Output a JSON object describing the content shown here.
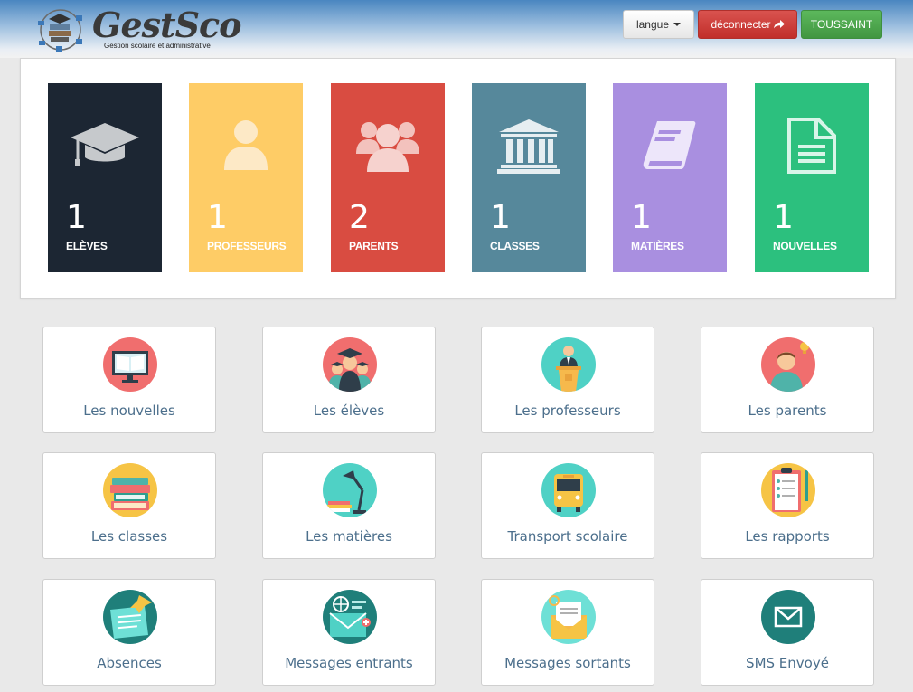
{
  "header": {
    "logo_text": "GestSco",
    "logo_subtitle": "Gestion scolaire et administrative",
    "langue_label": "langue",
    "logout_label": "déconnecter",
    "user_label": "TOUSSAINT"
  },
  "stats": [
    {
      "value": "1",
      "label": "ELÈVES",
      "color": "#1c2633",
      "icon": "graduation-cap-icon"
    },
    {
      "value": "1",
      "label": "PROFESSEURS",
      "color": "#fecc66",
      "icon": "user-icon"
    },
    {
      "value": "2",
      "label": "PARENTS",
      "color": "#d94c41",
      "icon": "users-icon"
    },
    {
      "value": "1",
      "label": "CLASSES",
      "color": "#56889b",
      "icon": "institution-icon"
    },
    {
      "value": "1",
      "label": "MATIÈRES",
      "color": "#a98fe0",
      "icon": "book-icon"
    },
    {
      "value": "1",
      "label": "NOUVELLES",
      "color": "#2cc07e",
      "icon": "document-icon"
    }
  ],
  "tiles": [
    {
      "label": "Les nouvelles",
      "icon": "monitor-news-icon"
    },
    {
      "label": "Les élèves",
      "icon": "students-icon"
    },
    {
      "label": "Les professeurs",
      "icon": "teacher-icon"
    },
    {
      "label": "Les parents",
      "icon": "parent-icon"
    },
    {
      "label": "Les classes",
      "icon": "books-icon"
    },
    {
      "label": "Les matières",
      "icon": "desk-lamp-icon"
    },
    {
      "label": "Transport scolaire",
      "icon": "school-bus-icon"
    },
    {
      "label": "Les rapports",
      "icon": "clipboard-icon"
    },
    {
      "label": "Absences",
      "icon": "pinned-note-icon"
    },
    {
      "label": "Messages entrants",
      "icon": "inbox-mail-icon"
    },
    {
      "label": "Messages sortants",
      "icon": "outbox-mail-icon"
    },
    {
      "label": "SMS Envoyé",
      "icon": "sms-envelope-icon"
    }
  ]
}
